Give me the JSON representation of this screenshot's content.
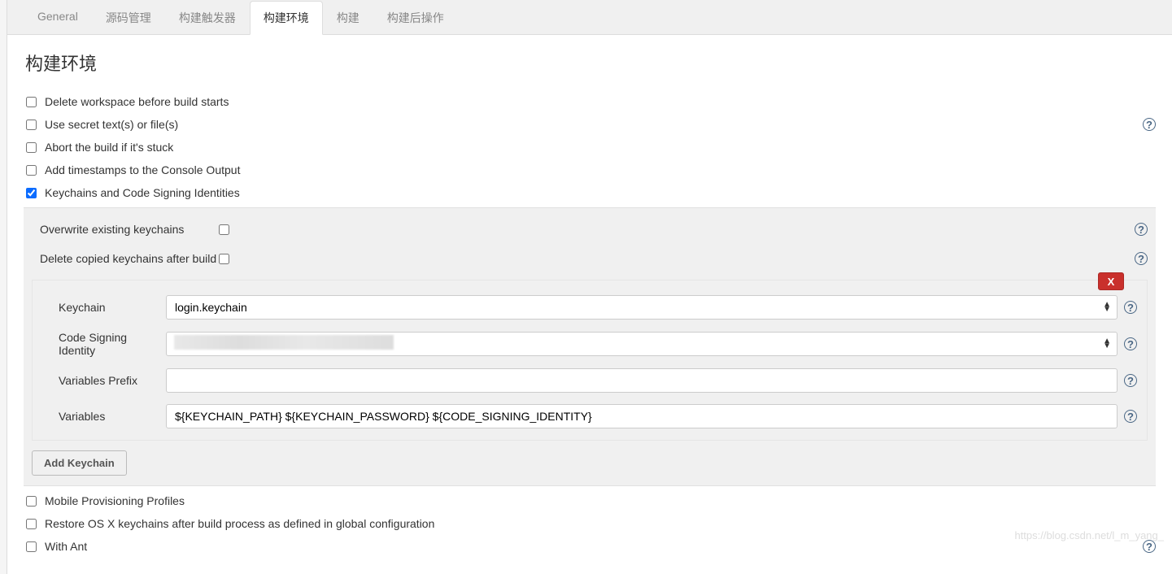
{
  "tabs": [
    {
      "label": "General",
      "active": false
    },
    {
      "label": "源码管理",
      "active": false
    },
    {
      "label": "构建触发器",
      "active": false
    },
    {
      "label": "构建环境",
      "active": true
    },
    {
      "label": "构建",
      "active": false
    },
    {
      "label": "构建后操作",
      "active": false
    }
  ],
  "section_title": "构建环境",
  "options": {
    "delete_workspace": {
      "label": "Delete workspace before build starts",
      "checked": false,
      "help": false
    },
    "secret_text": {
      "label": "Use secret text(s) or file(s)",
      "checked": false,
      "help": true
    },
    "abort_stuck": {
      "label": "Abort the build if it's stuck",
      "checked": false,
      "help": false
    },
    "add_timestamps": {
      "label": "Add timestamps to the Console Output",
      "checked": false,
      "help": false
    },
    "keychains": {
      "label": "Keychains and Code Signing Identities",
      "checked": true,
      "help": false
    },
    "mobile_provisioning": {
      "label": "Mobile Provisioning Profiles",
      "checked": false,
      "help": false
    },
    "restore_osx": {
      "label": "Restore OS X keychains after build process as defined in global configuration",
      "checked": false,
      "help": false
    },
    "with_ant": {
      "label": "With Ant",
      "checked": false,
      "help": true
    }
  },
  "keychain_panel": {
    "overwrite": {
      "label": "Overwrite existing keychains",
      "checked": false
    },
    "delete_copied": {
      "label": "Delete copied keychains after build",
      "checked": false
    },
    "close_label": "X",
    "add_button": "Add Keychain",
    "fields": {
      "keychain": {
        "label": "Keychain",
        "value": "login.keychain"
      },
      "code_signing": {
        "label": "Code Signing Identity",
        "value": ""
      },
      "var_prefix": {
        "label": "Variables Prefix",
        "value": ""
      },
      "variables": {
        "label": "Variables",
        "value": "${KEYCHAIN_PATH} ${KEYCHAIN_PASSWORD} ${CODE_SIGNING_IDENTITY}"
      }
    }
  },
  "watermark": "https://blog.csdn.net/l_m_yang_"
}
